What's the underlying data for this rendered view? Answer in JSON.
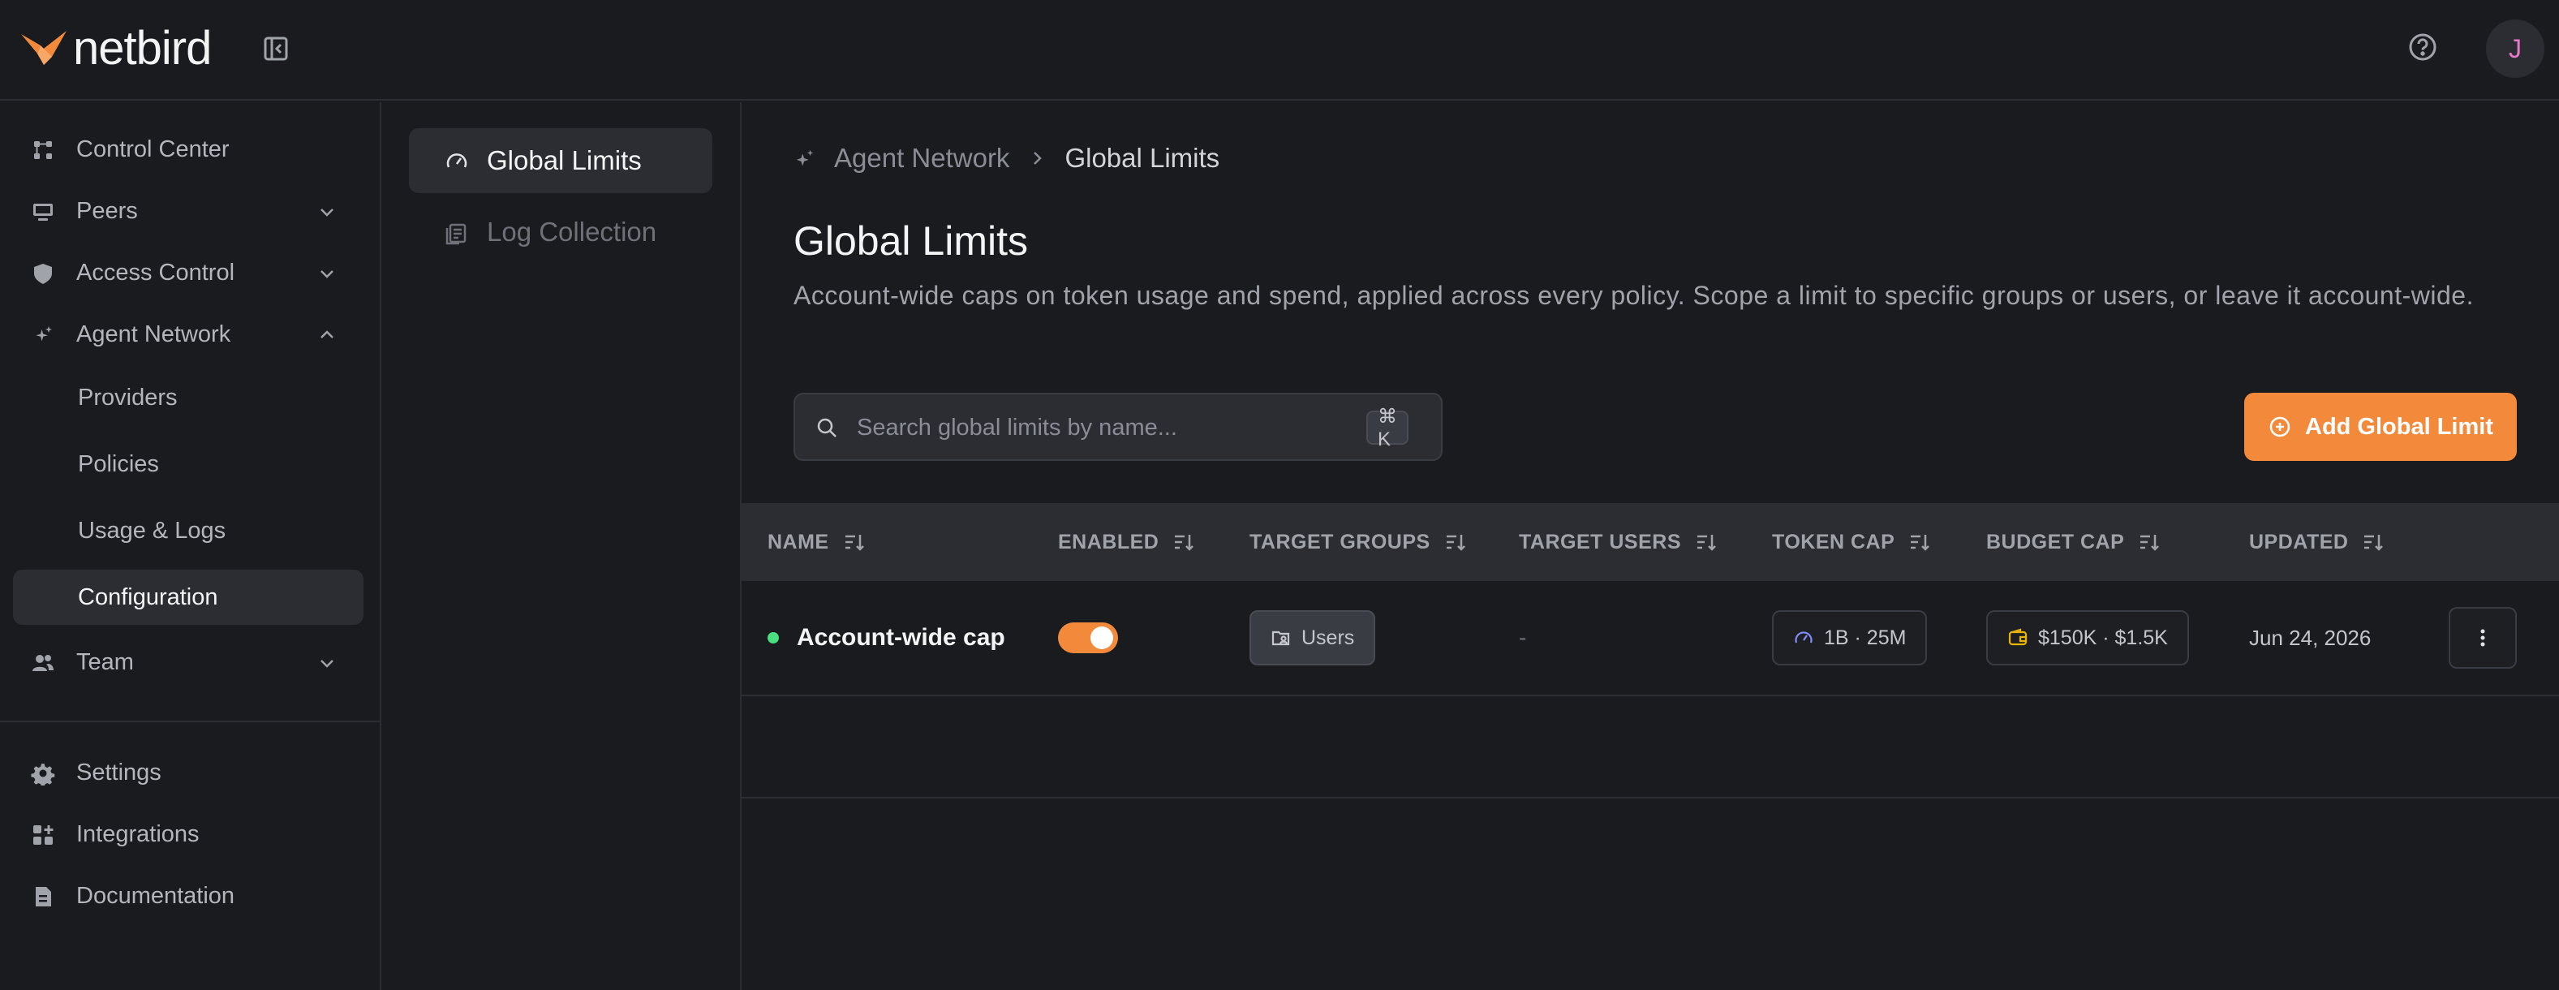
{
  "header": {
    "brand": "netbird",
    "avatar_initial": "J"
  },
  "sidebar": {
    "items": [
      {
        "label": "Control Center"
      },
      {
        "label": "Peers"
      },
      {
        "label": "Access Control"
      },
      {
        "label": "Agent Network"
      },
      {
        "label": "Providers"
      },
      {
        "label": "Policies"
      },
      {
        "label": "Usage & Logs"
      },
      {
        "label": "Configuration"
      },
      {
        "label": "Team"
      },
      {
        "label": "Settings"
      },
      {
        "label": "Integrations"
      },
      {
        "label": "Documentation"
      }
    ]
  },
  "subnav": {
    "items": [
      {
        "label": "Global Limits"
      },
      {
        "label": "Log Collection"
      }
    ]
  },
  "breadcrumb": {
    "parent": "Agent Network",
    "current": "Global Limits"
  },
  "page": {
    "title": "Global Limits",
    "description": "Account-wide caps on token usage and spend, applied across every policy. Scope a limit to specific groups or users, or leave it account-wide."
  },
  "search": {
    "placeholder": "Search global limits by name...",
    "shortcut": "⌘ K"
  },
  "actions": {
    "add_label": "Add Global Limit"
  },
  "table": {
    "columns": [
      "NAME",
      "ENABLED",
      "TARGET GROUPS",
      "TARGET USERS",
      "TOKEN CAP",
      "BUDGET CAP",
      "UPDATED"
    ],
    "rows": [
      {
        "name": "Account-wide cap",
        "enabled": true,
        "target_group": "Users",
        "target_users": "-",
        "token_cap": "1B · 25M",
        "budget_cap": "$150K · $1.5K",
        "updated": "Jun 24, 2026"
      }
    ]
  },
  "colors": {
    "accent": "#f38a3b",
    "status_active": "#4ade80",
    "background": "#1a1b1f",
    "surface": "#2b2d33"
  }
}
